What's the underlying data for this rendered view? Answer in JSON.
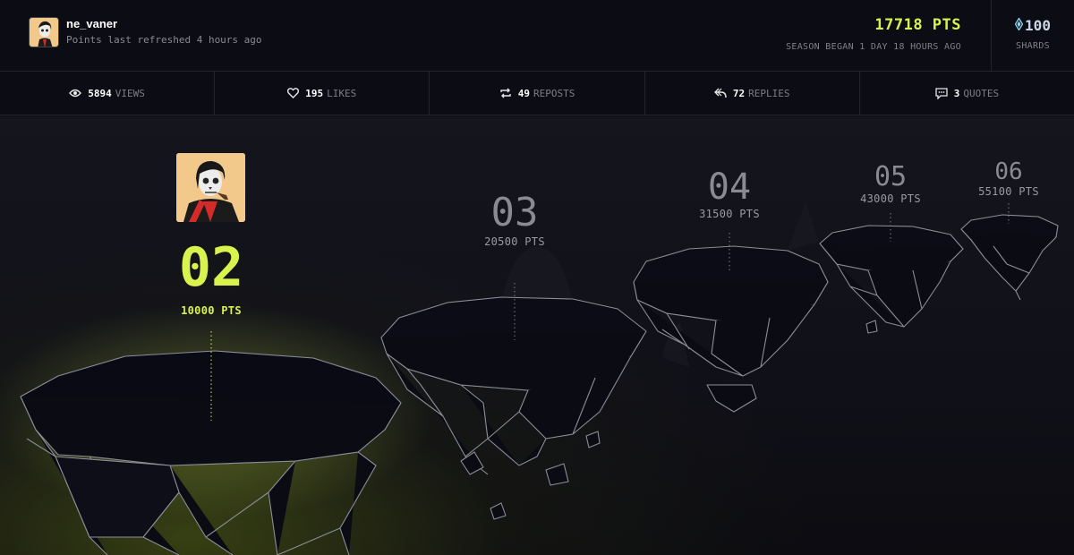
{
  "user": {
    "username": "ne_vaner",
    "refresh_note": "Points last refreshed 4 hours ago"
  },
  "points": {
    "value": "17718 PTS",
    "season": "SEASON BEGAN 1 DAY 18 HOURS AGO"
  },
  "shards": {
    "value": "100",
    "label": "SHARDS",
    "icon": "diamond-icon"
  },
  "stats": [
    {
      "count": "5894",
      "label": "VIEWS",
      "icon": "eye-icon"
    },
    {
      "count": "195",
      "label": "LIKES",
      "icon": "heart-icon"
    },
    {
      "count": "49",
      "label": "REPOSTS",
      "icon": "repost-icon"
    },
    {
      "count": "72",
      "label": "REPLIES",
      "icon": "reply-icon"
    },
    {
      "count": "3",
      "label": "QUOTES",
      "icon": "quote-icon"
    }
  ],
  "levels": [
    {
      "number": "02",
      "points": "10000 PTS",
      "current": true
    },
    {
      "number": "03",
      "points": "20500 PTS",
      "current": false
    },
    {
      "number": "04",
      "points": "31500 PTS",
      "current": false
    },
    {
      "number": "05",
      "points": "43000 PTS",
      "current": false
    },
    {
      "number": "06",
      "points": "55100 PTS",
      "current": false
    }
  ],
  "colors": {
    "accent": "#d9f24d",
    "background": "#0b0b12",
    "muted": "#80808c",
    "avatar_bg": "#f3c98b",
    "avatar_shirt": "#d42a2a"
  }
}
